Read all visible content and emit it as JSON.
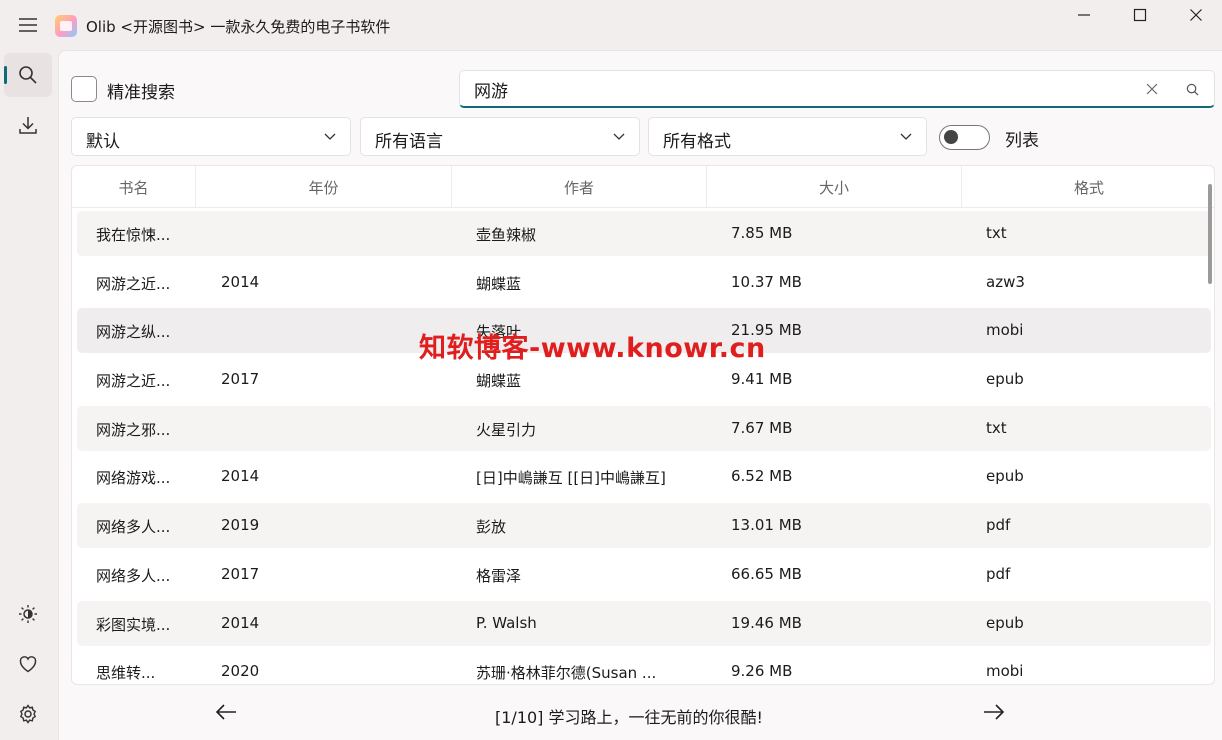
{
  "app": {
    "title": "Olib <开源图书> 一款永久免费的电子书软件"
  },
  "search": {
    "precise_label": "精准搜索",
    "query": "网游",
    "sort": "默认",
    "language": "所有语言",
    "format": "所有格式",
    "list_label": "列表"
  },
  "table": {
    "headers": [
      "书名",
      "年份",
      "作者",
      "大小",
      "格式"
    ],
    "rows": [
      {
        "title": "我在惊悚...",
        "year": "",
        "author": "壶鱼辣椒",
        "size": "7.85 MB",
        "format": "txt"
      },
      {
        "title": "网游之近...",
        "year": "2014",
        "author": "蝴蝶蓝",
        "size": "10.37 MB",
        "format": "azw3"
      },
      {
        "title": "网游之纵...",
        "year": "",
        "author": "失落叶",
        "size": "21.95 MB",
        "format": "mobi"
      },
      {
        "title": "网游之近...",
        "year": "2017",
        "author": "蝴蝶蓝",
        "size": "9.41 MB",
        "format": "epub"
      },
      {
        "title": "网游之邪...",
        "year": "",
        "author": "火星引力",
        "size": "7.67 MB",
        "format": "txt"
      },
      {
        "title": "网络游戏...",
        "year": "2014",
        "author": "[日]中嶋謙互 [[日]中嶋謙互]",
        "size": "6.52 MB",
        "format": "epub"
      },
      {
        "title": "网络多人...",
        "year": "2019",
        "author": "彭放",
        "size": "13.01 MB",
        "format": "pdf"
      },
      {
        "title": "网络多人...",
        "year": "2017",
        "author": "格雷泽",
        "size": "66.65 MB",
        "format": "pdf"
      },
      {
        "title": "彩图实境...",
        "year": "2014",
        "author": "P. Walsh",
        "size": "19.46 MB",
        "format": "epub"
      },
      {
        "title": "思维转...",
        "year": "2020",
        "author": "苏珊·格林菲尔德(Susan ...",
        "size": "9.26 MB",
        "format": "mobi"
      }
    ]
  },
  "watermark": "知软博客-www.knowr.cn",
  "pagination": {
    "text": "[1/10] 学习路上，一往无前的你很酷!"
  },
  "colors": {
    "accent": "#0f6a77",
    "watermark": "#e01e1e"
  },
  "icons": [
    "hamburger-menu-icon",
    "search-icon",
    "download-icon",
    "theme-icon",
    "heart-icon",
    "gear-icon",
    "close-icon",
    "chevron-down-icon",
    "arrow-left-icon",
    "arrow-right-icon"
  ]
}
